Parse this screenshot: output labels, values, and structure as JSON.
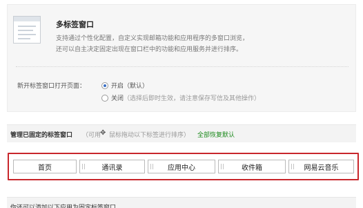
{
  "section": {
    "title": "多标签窗口",
    "desc_line1": "支持通过个性化配置，自定义实现邮箱功能和应用程序的多窗口浏览，",
    "desc_line2": "还可以自主决定固定出现在窗口栏中的功能和应用服务并进行排序。"
  },
  "setting": {
    "label": "新开标签窗口打开页面：",
    "option_on": "开启（默认）",
    "option_off": "关闭",
    "option_off_note": "（选择后即时生效，请注意保存写信及其他操作）",
    "selected": "开启"
  },
  "pinned": {
    "title": "管理已固定的标签窗口",
    "hint_prefix": "（可用",
    "hint_suffix": "鼠标拖动以下标签进行排序）",
    "restore_link": "全部恢复默认",
    "tabs": [
      "首页",
      "通讯录",
      "应用中心",
      "收件箱",
      "网易云音乐"
    ]
  },
  "bottom": {
    "text": "你还可以添加以下应用为固定标签窗口"
  }
}
